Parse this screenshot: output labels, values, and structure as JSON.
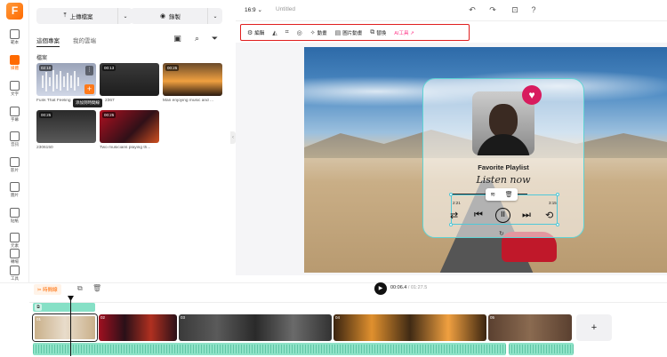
{
  "app": {
    "logo_letter": "F",
    "project_title": "Untitled",
    "aspect_ratio": "16:9 ⌄"
  },
  "rail": {
    "items": [
      {
        "label": "範本",
        "icon": "template-icon",
        "active": false
      },
      {
        "label": "媒體",
        "icon": "media-folder-icon",
        "active": true
      },
      {
        "label": "文字",
        "icon": "text-icon",
        "active": false
      },
      {
        "label": "字幕",
        "icon": "subtitle-icon",
        "active": false
      },
      {
        "label": "音訊",
        "icon": "audio-icon",
        "active": false
      },
      {
        "label": "影片",
        "icon": "video-icon",
        "active": false
      },
      {
        "label": "圖片",
        "icon": "image-icon",
        "active": false
      },
      {
        "label": "貼紙",
        "icon": "sticker-icon",
        "active": false
      },
      {
        "label": "元素",
        "icon": "elements-icon",
        "active": false
      },
      {
        "label": "轉場",
        "icon": "transition-icon",
        "active": false
      },
      {
        "label": "工具",
        "icon": "tools-icon",
        "active": false
      }
    ]
  },
  "media": {
    "upload_label": "上傳檔案",
    "record_label": "錄製",
    "tabs": [
      "這個專案",
      "我的雲端"
    ],
    "section_label": "檔案",
    "tooltip": "添加到時間線",
    "items": [
      {
        "duration": "02:10",
        "caption": "Funk That Feeling"
      },
      {
        "duration": "00:13",
        "caption": "2367"
      },
      {
        "duration": "00:25",
        "caption": "Man enjoying music and ..."
      },
      {
        "duration": "00:25",
        "caption": "2306150"
      },
      {
        "duration": "00:25",
        "caption": "Two musicians playing th..."
      }
    ]
  },
  "toolbar": {
    "items": [
      {
        "label": "編輯",
        "icon": "sliders-icon"
      },
      {
        "label": "",
        "icon": "flip-icon"
      },
      {
        "label": "",
        "icon": "crop-icon"
      },
      {
        "label": "",
        "icon": "opacity-icon"
      },
      {
        "label": "動畫",
        "icon": "animation-icon"
      },
      {
        "label": "圖片動畫",
        "icon": "image-animation-icon"
      },
      {
        "label": "替換",
        "icon": "replace-icon"
      },
      {
        "label": "AI工具 ↗",
        "icon": "ai-tools-icon"
      }
    ]
  },
  "player_card": {
    "title": "Favorite Playlist",
    "subtitle": "Listen now",
    "time_left": "2:21",
    "time_right": "3:15"
  },
  "timeline": {
    "split_label": "✂ 時間線",
    "current_time": "00:06.4",
    "total_time": " / 01:27.5",
    "clips": [
      {
        "num": "01"
      },
      {
        "num": "02"
      },
      {
        "num": "03"
      },
      {
        "num": "04"
      },
      {
        "num": "05"
      }
    ],
    "add_label": "+"
  },
  "colors": {
    "accent": "#ff6a00",
    "highlight_border": "#e01f1f",
    "selection": "#4fc8d8",
    "audio_track": "#8fe3c8"
  }
}
